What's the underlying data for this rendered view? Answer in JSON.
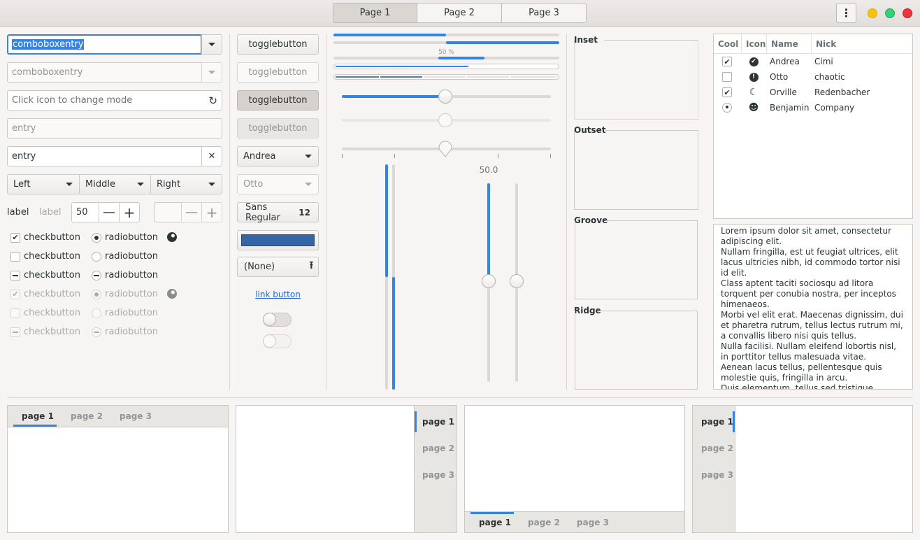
{
  "header": {
    "tabs": [
      "Page 1",
      "Page 2",
      "Page 3"
    ],
    "active_tab": 0,
    "menu_icon": "⋮"
  },
  "left": {
    "combo1_value": "comboboxentry",
    "combo2_value": "comboboxentry",
    "entry_icon_placeholder": "Click icon to change mode",
    "entry_disabled_placeholder": "entry",
    "entry_clear_value": "entry",
    "segmented": [
      "Left",
      "Middle",
      "Right"
    ],
    "label1": "label",
    "label2": "label",
    "spin_value": "50",
    "checkbuttons": [
      "checkbutton",
      "checkbutton",
      "checkbutton",
      "checkbutton",
      "checkbutton",
      "checkbutton"
    ],
    "radiobuttons": [
      "radiobutton",
      "radiobutton",
      "radiobutton",
      "radiobutton",
      "radiobutton",
      "radiobutton"
    ]
  },
  "middle": {
    "togglebuttons": [
      "togglebutton",
      "togglebutton",
      "togglebutton",
      "togglebutton"
    ],
    "combo_andrea": "Andrea",
    "combo_otto": "Otto",
    "font_name": "Sans Regular",
    "font_size": "12",
    "color_hex": "#3465a4",
    "file_label": "(None)",
    "link_label": "link button"
  },
  "progress": {
    "bar1": 0.5,
    "bar2_start": 0.5,
    "bar_text": "50 %",
    "bar3": 0.5,
    "bar4": 0.6,
    "scale_value_label": "50.0",
    "slider1": 0.5,
    "slider2": 0.5,
    "slider3": 0.5,
    "vslider1": 0.5,
    "vslider2": 0.5
  },
  "frames": [
    "Inset",
    "Outset",
    "Groove",
    "Ridge"
  ],
  "tree": {
    "columns": [
      "Cool",
      "Icon",
      "Name",
      "Nick"
    ],
    "rows": [
      {
        "cool": "✔",
        "icon": "✔",
        "name": "Andrea",
        "nick": "Cimi"
      },
      {
        "cool": "",
        "icon": "!",
        "name": "Otto",
        "nick": "chaotic"
      },
      {
        "cool": "✔",
        "icon": "☾",
        "name": "Orville",
        "nick": "Redenbacher"
      },
      {
        "cool": "•",
        "icon": "☻",
        "name": "Benjamin",
        "nick": "Company"
      }
    ]
  },
  "textview": [
    "Lorem ipsum dolor sit amet, consectetur adipiscing elit.",
    "Nullam fringilla, est ut feugiat ultrices, elit lacus ultricies nibh, id commodo tortor nisi id elit.",
    "Class aptent taciti sociosqu ad litora torquent per conubia nostra, per inceptos himenaeos.",
    "Morbi vel elit erat. Maecenas dignissim, dui et pharetra rutrum, tellus lectus rutrum mi, a convallis libero nisi quis tellus.",
    "Nulla facilisi. Nullam eleifend lobortis nisl, in porttitor tellus malesuada vitae.",
    "Aenean lacus tellus, pellentesque quis molestie quis, fringilla in arcu.",
    "Duis elementum, tellus sed tristique semper, metus metus accumsan augue, et porttitor"
  ],
  "notebooks": {
    "tabs": [
      "page 1",
      "page 2",
      "page 3"
    ]
  },
  "colors": {
    "accent": "#3584e4",
    "color_button": "#3465a4"
  }
}
